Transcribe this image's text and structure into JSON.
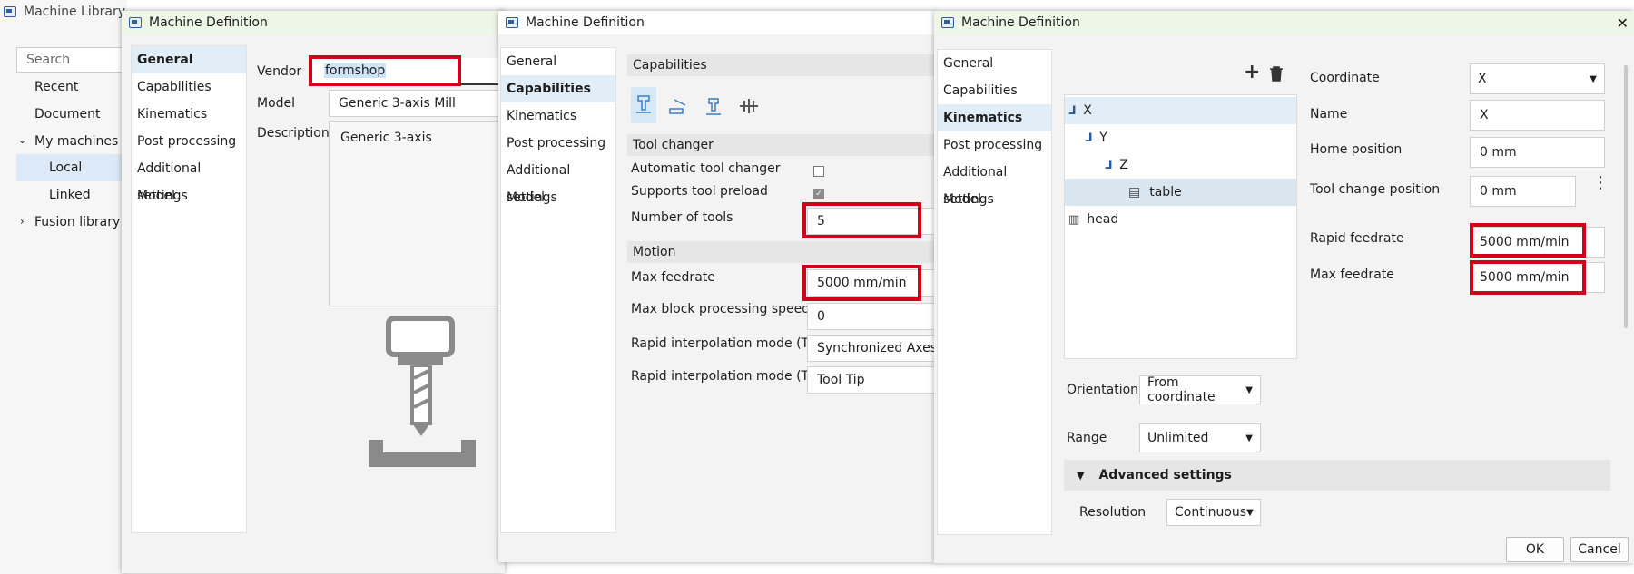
{
  "library": {
    "title": "Machine Library",
    "search_placeholder": "Search",
    "nav": [
      "Recent",
      "Document",
      "My machines",
      "Local",
      "Linked",
      "Fusion library"
    ]
  },
  "panel1": {
    "title": "Machine Definition",
    "nav": [
      "General",
      "Capabilities",
      "Kinematics",
      "Post processing",
      "Additional settings",
      "Model"
    ],
    "vendor_label": "Vendor",
    "vendor_value": "formshop",
    "model_label": "Model",
    "model_value": "Generic 3-axis Mill",
    "description_label": "Description",
    "description_value": "Generic 3-axis"
  },
  "panel2": {
    "title": "Machine Definition",
    "nav": [
      "General",
      "Capabilities",
      "Kinematics",
      "Post processing",
      "Additional settings",
      "Model"
    ],
    "capabilities_header": "Capabilities",
    "tool_changer_header": "Tool changer",
    "automatic_tool_changer": "Automatic tool changer",
    "supports_tool_preload": "Supports tool preload",
    "number_of_tools_label": "Number of tools",
    "number_of_tools_value": "5",
    "motion_header": "Motion",
    "max_feedrate_label": "Max feedrate",
    "max_feedrate_value": "5000 mm/min",
    "max_block_label": "Max block processing speed",
    "max_block_value": "0",
    "rapid_off_label": "Rapid interpolation mode (TCP off)",
    "rapid_off_value": "Synchronized Axes",
    "rapid_on_label": "Rapid interpolation mode (TCP on)",
    "rapid_on_value": "Tool Tip"
  },
  "panel3": {
    "title": "Machine Definition",
    "nav": [
      "General",
      "Capabilities",
      "Kinematics",
      "Post processing",
      "Additional settings",
      "Model"
    ],
    "tree": [
      "X",
      "Y",
      "Z",
      "table",
      "head"
    ],
    "coordinate_label": "Coordinate",
    "coordinate_value": "X",
    "name_label": "Name",
    "name_value": "X",
    "home_label": "Home position",
    "home_value": "0 mm",
    "toolchange_label": "Tool change position",
    "toolchange_value": "0 mm",
    "rapid_label": "Rapid feedrate",
    "rapid_value": "5000 mm/min",
    "maxfeed_label": "Max feedrate",
    "maxfeed_value": "5000 mm/min",
    "orientation_label": "Orientation",
    "orientation_value": "From coordinate",
    "range_label": "Range",
    "range_value": "Unlimited",
    "advanced_label": "Advanced settings",
    "resolution_label": "Resolution",
    "resolution_value": "Continuous",
    "ok_label": "OK",
    "cancel_label": "Cancel",
    "close_glyph": "✕"
  }
}
